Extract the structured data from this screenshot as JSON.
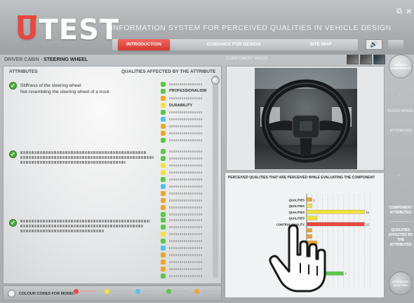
{
  "window": {
    "logo_text": "TEST",
    "logo_first": "U",
    "title": "INFORMATION SYSTEM FOR PERCEIVED QUALITIES IN VEHICLE DESIGN",
    "restore_icon": "restore-icon",
    "close_icon": "close-icon"
  },
  "nav": {
    "tabs": [
      {
        "label": "INTRODUCTION",
        "active": true
      },
      {
        "label": "GUIDANCE FOR DESIGN",
        "active": false
      },
      {
        "label": "SITE MAP",
        "active": false
      }
    ],
    "speaker_icon": "speaker-icon"
  },
  "breadcrumb": {
    "section": "DRIVER CABIN",
    "separator": " - ",
    "item": "STEERING WHEEL"
  },
  "image_label": "COMPONENT IMAGE",
  "attributes_panel": {
    "col_attributes": "ATTRIBUTES",
    "col_qualities": "QUALITIES AFFECTED BY THE ATTRIBUTE",
    "first_attribute": {
      "line1": "Stiffness of the steering wheel",
      "line2": "Not resembling the steering wheel of a truck"
    },
    "first_qualities": [
      "PROFESSIONALISM",
      "DURABILITY"
    ]
  },
  "legend": {
    "title": "COLOUR CODES FOR MODEL",
    "items": [
      {
        "color": "#e8473f"
      },
      {
        "color": "#f2e23a"
      },
      {
        "color": "#4fc3e8"
      },
      {
        "color": "#5cc84a"
      },
      {
        "color": "#f0a42c"
      }
    ]
  },
  "chart_panel": {
    "title": "PERCEIVED QUALITIES THAT ARE PERCEIVED WHILE EVALUATING THE COMPONENT"
  },
  "chart_data": {
    "type": "bar",
    "orientation": "horizontal",
    "categories": [
      "QUALITIES",
      "QUALITIES",
      "QUALITIES",
      "QUALITIES",
      "CONTROL QUALITY",
      "",
      "",
      "",
      "",
      "",
      "",
      "",
      "",
      "",
      ""
    ],
    "values": [
      1,
      1,
      11,
      2,
      11,
      1,
      1,
      2,
      1,
      1,
      2,
      2,
      7,
      1,
      1
    ],
    "bar_colors": [
      "#f0a42c",
      "#f2e23a",
      "#f2e23a",
      "#f2e23a",
      "#e8473f",
      "#f0a42c",
      "#f0a42c",
      "#f0a42c",
      "#5cc84a",
      "#5cc84a",
      "#5cc84a",
      "#4fc3e8",
      "#5cc84a",
      "#f0a42c",
      "#f0a42c"
    ],
    "value_labels": [
      "1",
      "",
      "11",
      "",
      "11",
      "",
      "",
      "",
      "1",
      "",
      "",
      "",
      "7",
      "",
      ""
    ],
    "xlim": [
      0,
      12
    ],
    "grid": true
  },
  "right_column": {
    "top_button": "PRODUCT COMPONENTS",
    "faded_1": "BLOCK MODEL",
    "faded_2": "ATTRIBUTES",
    "item_1": "COMPONENT ATTRIBUTES",
    "item_2": "QUALITIES AFFECTED BY THE ATTRIBUTES",
    "bottom_button": "PERCEIVED QUALITIES"
  }
}
